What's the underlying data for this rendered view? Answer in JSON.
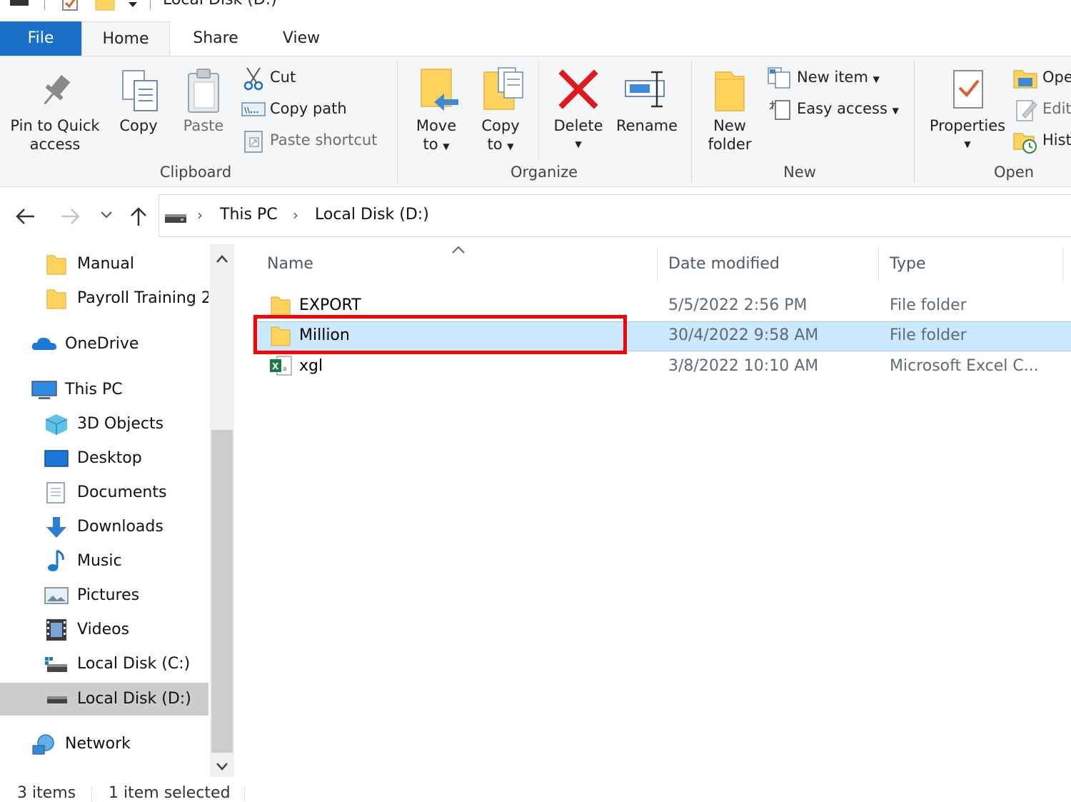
{
  "titlebar": {
    "title": "Local Disk (D:)"
  },
  "tabs": [
    {
      "label": "File"
    },
    {
      "label": "Home"
    },
    {
      "label": "Share"
    },
    {
      "label": "View"
    }
  ],
  "ribbon": {
    "clipboard": {
      "pin_line1": "Pin to Quick",
      "pin_line2": "access",
      "copy": "Copy",
      "paste": "Paste",
      "cut": "Cut",
      "copy_path": "Copy path",
      "paste_shortcut": "Paste shortcut",
      "group": "Clipboard"
    },
    "organize": {
      "move_line1": "Move",
      "move_line2": "to",
      "copy_line1": "Copy",
      "copy_line2": "to",
      "delete": "Delete",
      "rename": "Rename",
      "group": "Organize"
    },
    "new": {
      "folder_line1": "New",
      "folder_line2": "folder",
      "new_item": "New item",
      "easy_access": "Easy access",
      "group": "New"
    },
    "open": {
      "properties": "Properties",
      "open": "Ope",
      "edit": "Edit",
      "history": "Hist",
      "group": "Open"
    }
  },
  "address": {
    "crumbs": [
      "This PC",
      "Local Disk (D:)"
    ]
  },
  "nav": {
    "items": [
      {
        "label": "Manual",
        "icon": "folder-icon"
      },
      {
        "label": "Payroll Training 2",
        "icon": "folder-icon"
      },
      {
        "label": "OneDrive",
        "icon": "onedrive-icon"
      },
      {
        "label": "This PC",
        "icon": "computer-icon"
      },
      {
        "label": "3D Objects",
        "icon": "3d-objects-icon"
      },
      {
        "label": "Desktop",
        "icon": "desktop-icon"
      },
      {
        "label": "Documents",
        "icon": "documents-icon"
      },
      {
        "label": "Downloads",
        "icon": "downloads-icon"
      },
      {
        "label": "Music",
        "icon": "music-icon"
      },
      {
        "label": "Pictures",
        "icon": "pictures-icon"
      },
      {
        "label": "Videos",
        "icon": "videos-icon"
      },
      {
        "label": "Local Disk (C:)",
        "icon": "drive-icon"
      },
      {
        "label": "Local Disk (D:)",
        "icon": "drive-icon",
        "selected": true
      },
      {
        "label": "Network",
        "icon": "network-icon"
      }
    ]
  },
  "files": {
    "columns": [
      "Name",
      "Date modified",
      "Type"
    ],
    "rows": [
      {
        "name": "EXPORT",
        "date": "5/5/2022 2:56 PM",
        "type": "File folder",
        "icon": "folder-icon"
      },
      {
        "name": "Million",
        "date": "30/4/2022 9:58 AM",
        "type": "File folder",
        "icon": "folder-icon",
        "selected": true
      },
      {
        "name": "xgl",
        "date": "3/8/2022 10:10 AM",
        "type": "Microsoft Excel C...",
        "icon": "excel-file-icon"
      }
    ]
  },
  "status": {
    "count": "3 items",
    "selected": "1 item selected"
  },
  "colors": {
    "accent": "#1a6fc9",
    "selection": "#cce8ff",
    "highlight_box": "#ff0000",
    "folder": "#ffd35c"
  }
}
